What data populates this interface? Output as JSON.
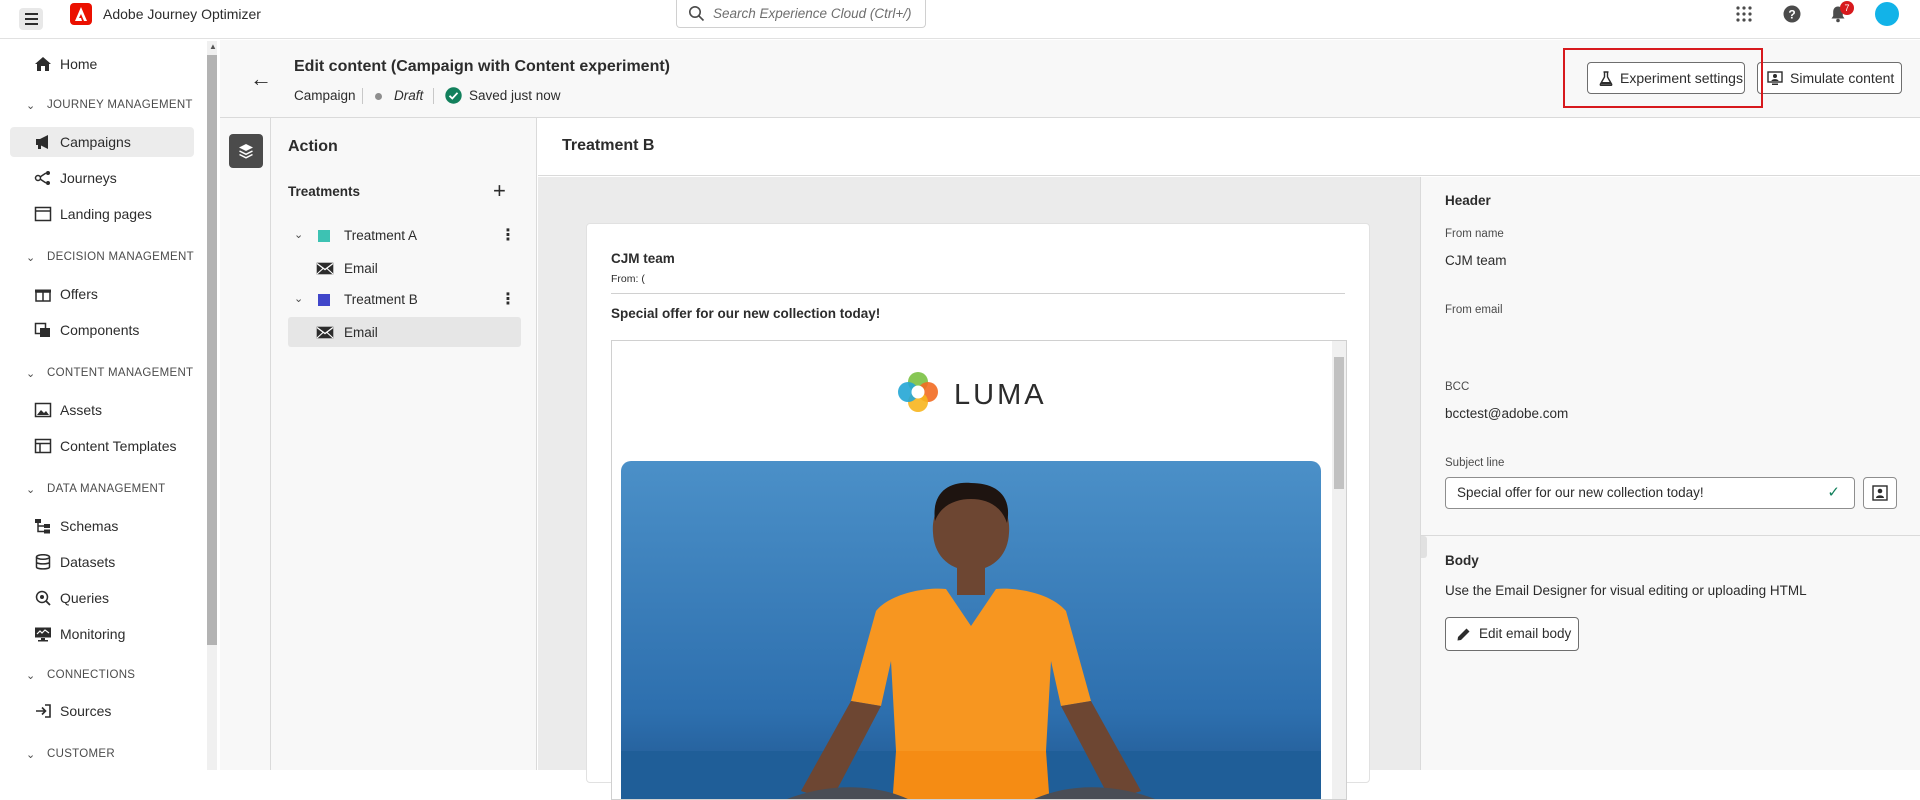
{
  "app": {
    "title": "Adobe Journey Optimizer",
    "search_placeholder": "Search Experience Cloud (Ctrl+/)",
    "notification_count": "7"
  },
  "sidebar": {
    "home": "Home",
    "sections": {
      "journey_mgmt": "JOURNEY MANAGEMENT",
      "decision_mgmt": "DECISION MANAGEMENT",
      "content_mgmt": "CONTENT MANAGEMENT",
      "data_mgmt": "DATA MANAGEMENT",
      "connections": "CONNECTIONS",
      "customer": "CUSTOMER"
    },
    "items": {
      "campaigns": "Campaigns",
      "journeys": "Journeys",
      "landing_pages": "Landing pages",
      "offers": "Offers",
      "components": "Components",
      "assets": "Assets",
      "content_templates": "Content Templates",
      "schemas": "Schemas",
      "datasets": "Datasets",
      "queries": "Queries",
      "monitoring": "Monitoring",
      "sources": "Sources"
    }
  },
  "header": {
    "title": "Edit content (Campaign with Content experiment)",
    "type": "Campaign",
    "status": "Draft",
    "saved": "Saved just now",
    "experiment_button": "Experiment settings",
    "simulate_button": "Simulate content"
  },
  "action_panel": {
    "title": "Action",
    "treatments_label": "Treatments",
    "treatments": [
      {
        "name": "Treatment A",
        "color": "#3dc2b3",
        "channel": "Email"
      },
      {
        "name": "Treatment B",
        "color": "#4046ca",
        "channel": "Email"
      }
    ]
  },
  "main": {
    "treatment_title": "Treatment B",
    "email": {
      "from_name": "CJM team",
      "from_line": "From: (",
      "subject": "Special offer for our new collection today!",
      "brand": "LUMA"
    }
  },
  "properties": {
    "header_title": "Header",
    "from_name_label": "From name",
    "from_name_value": "CJM team",
    "from_email_label": "From email",
    "bcc_label": "BCC",
    "bcc_value": "bcctest@adobe.com",
    "subject_label": "Subject line",
    "subject_value": "Special offer for our new collection today!",
    "body_title": "Body",
    "body_desc": "Use the Email Designer for visual editing or uploading HTML",
    "edit_body_button": "Edit email body"
  }
}
